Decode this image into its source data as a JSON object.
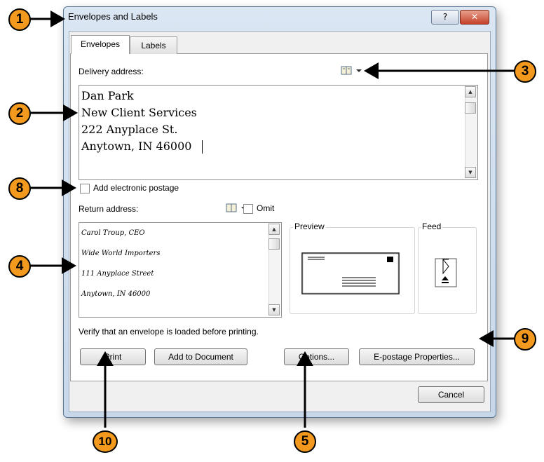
{
  "window": {
    "title": "Envelopes and Labels",
    "help_label": "?",
    "close_label": "✕"
  },
  "tabs": [
    {
      "label": "Envelopes"
    },
    {
      "label": "Labels"
    }
  ],
  "delivery": {
    "label": "Delivery address:",
    "lines": [
      "Dan Park",
      "New Client Services",
      "222 Anyplace St.",
      "Anytown, IN 46000"
    ]
  },
  "postage": {
    "label": "Add electronic postage",
    "checked": false
  },
  "return": {
    "label": "Return address:",
    "omit_label": "Omit",
    "lines": [
      "Carol Troup, CEO",
      "Wide World Importers",
      "111 Anyplace Street",
      "Anytown, IN 46000"
    ]
  },
  "preview": {
    "label": "Preview"
  },
  "feed": {
    "label": "Feed"
  },
  "status_text": "Verify that an envelope is loaded before printing.",
  "buttons": {
    "print": "Print",
    "add_to_document": "Add to Document",
    "options": "Options...",
    "epostage": "E-postage Properties...",
    "cancel": "Cancel"
  },
  "callouts": [
    "1",
    "2",
    "3",
    "4",
    "5",
    "8",
    "9",
    "10"
  ],
  "colors": {
    "callout": "#f39a1e",
    "close_button": "#c5422a",
    "title_bar": "#dbe6f3"
  }
}
